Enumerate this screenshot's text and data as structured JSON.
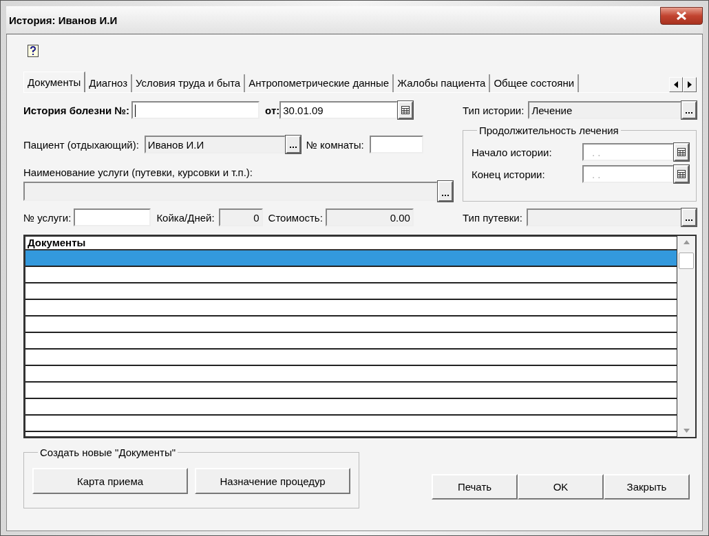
{
  "window": {
    "title": "История: Иванов И.И"
  },
  "tabs": [
    {
      "label": "Документы",
      "selected": true
    },
    {
      "label": "Диагноз",
      "selected": false
    },
    {
      "label": "Условия труда и быта",
      "selected": false
    },
    {
      "label": "Антропометрические данные",
      "selected": false
    },
    {
      "label": "Жалобы пациента",
      "selected": false
    },
    {
      "label": "Общее состояни",
      "selected": false
    }
  ],
  "form": {
    "history_number": {
      "label": "История болезни №:",
      "readonly": false
    },
    "date": {
      "label": "от:",
      "value": "30.01.09",
      "readonly": false
    },
    "history_type": {
      "label": "Тип истории:",
      "value": "Лечение",
      "readonly": true
    },
    "patient": {
      "label": "Пациент (отдыхающий):",
      "value": "Иванов И.И",
      "readonly": true
    },
    "room": {
      "label": "№ комнаты:",
      "readonly": false
    },
    "service_name": {
      "label": "Наименование услуги (путевки, курсовки и т.п.):",
      "readonly": true
    },
    "service_number": {
      "label": "№ услуги:",
      "readonly": false
    },
    "bed_days": {
      "label": "Койка/Дней:",
      "value": "0",
      "readonly": true
    },
    "cost": {
      "label": "Стоимость:",
      "value": "0.00",
      "readonly": true
    },
    "voucher_type": {
      "label": "Тип путевки:",
      "readonly": true
    }
  },
  "treatment_period": {
    "title": "Продолжительность лечения",
    "start": {
      "label": "Начало истории:",
      "placeholder": ". ."
    },
    "end": {
      "label": "Конец истории:",
      "placeholder": ". ."
    }
  },
  "table": {
    "columns": [
      "Документы"
    ],
    "rows": [
      {
        "selected": true
      },
      {
        "selected": false
      },
      {
        "selected": false
      },
      {
        "selected": false
      },
      {
        "selected": false
      },
      {
        "selected": false
      },
      {
        "selected": false
      },
      {
        "selected": false
      },
      {
        "selected": false
      },
      {
        "selected": false
      },
      {
        "selected": false
      }
    ]
  },
  "create_group": {
    "title": "Создать новые \"Документы\"",
    "buttons": [
      "Карта приема",
      "Назначение процедур"
    ]
  },
  "buttons": [
    "Печать",
    "OK",
    "Закрыть"
  ]
}
